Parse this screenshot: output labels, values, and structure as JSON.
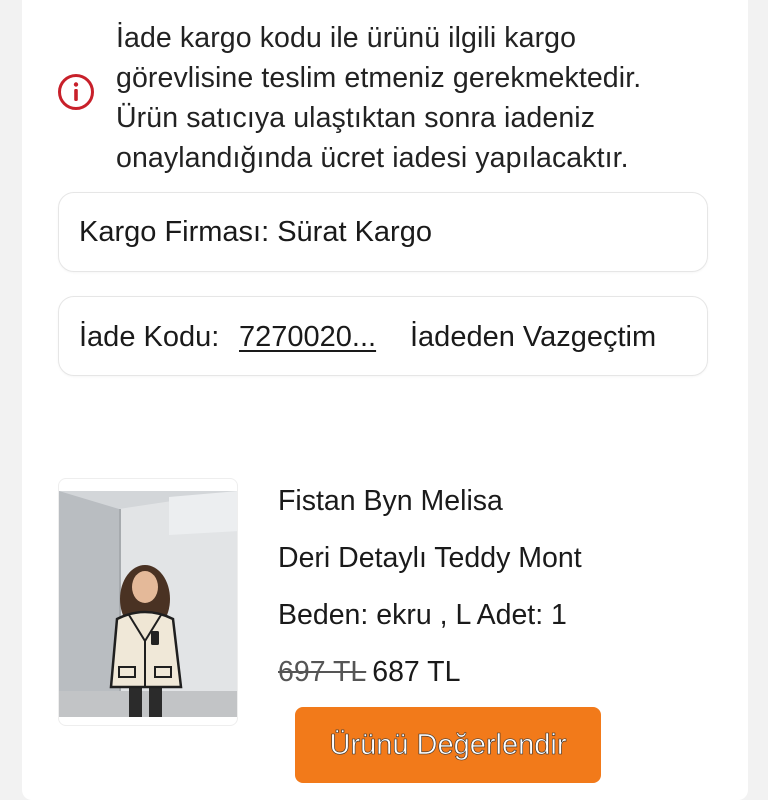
{
  "colors": {
    "accent": "#f27a1a",
    "info_icon": "#c8202a",
    "background": "#f2f2f2",
    "card": "#ffffff"
  },
  "info": {
    "icon": "info-circle-icon",
    "lines": [
      "İade kargo kodu ile ürünü ilgili kargo",
      "görevlisine teslim etmeniz gerekmektedir.",
      "Ürün satıcıya ulaştıktan sonra iadeniz",
      "onaylandığında ücret iadesi yapılacaktır."
    ]
  },
  "cargo": {
    "text": "Kargo Firması: Sürat Kargo"
  },
  "return": {
    "label": "İade Kodu:",
    "code": "7270020...",
    "cancel_label": "İadeden Vazgeçtim"
  },
  "product": {
    "image_icon": "product-photo",
    "brand": "Fistan Byn Melisa",
    "name": "Deri Detaylı Teddy Mont",
    "size_line": "Beden: ekru , L  Adet: 1",
    "old_price": "697 TL",
    "price": "687 TL",
    "rate_button": "Ürünü Değerlendir"
  }
}
